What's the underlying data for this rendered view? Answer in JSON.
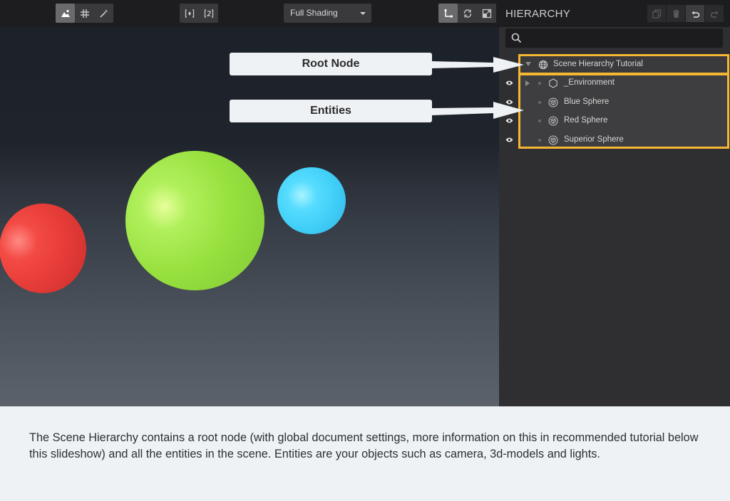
{
  "viewport": {
    "shading": {
      "selected": "Full Shading"
    },
    "toolbar_icons": [
      "scene-view-icon",
      "grid-icon",
      "magic-wand-icon",
      "frame-selection-icon",
      "frame-all-icon",
      "translate-icon",
      "rotate-icon",
      "scale-icon"
    ]
  },
  "hierarchy": {
    "title": "HIERARCHY",
    "search": {
      "placeholder": "",
      "value": ""
    },
    "header_icons": [
      "duplicate-icon",
      "delete-icon",
      "undo-icon",
      "redo-icon"
    ],
    "root": {
      "label": "Scene Hierarchy Tutorial",
      "icon": "globe-icon"
    },
    "items": [
      {
        "label": "_Environment",
        "icon": "hexagon-icon",
        "expandable": true
      },
      {
        "label": "Blue Sphere",
        "icon": "cube-icon",
        "expandable": false
      },
      {
        "label": "Red Sphere",
        "icon": "cube-icon",
        "expandable": false
      },
      {
        "label": "Superior Sphere",
        "icon": "cube-icon",
        "expandable": false
      }
    ]
  },
  "callouts": {
    "root": "Root Node",
    "entities": "Entities"
  },
  "caption": "The Scene Hierarchy contains a root node (with global document settings, more information on this in recommended tutorial below this slideshow) and all the entities in the scene. Entities are your objects such as camera, 3d-models and lights.",
  "colors": {
    "highlight": "#f5b733",
    "sphere_red": "#e63c38",
    "sphere_green": "#98e13f",
    "sphere_blue": "#3fcdf6"
  }
}
